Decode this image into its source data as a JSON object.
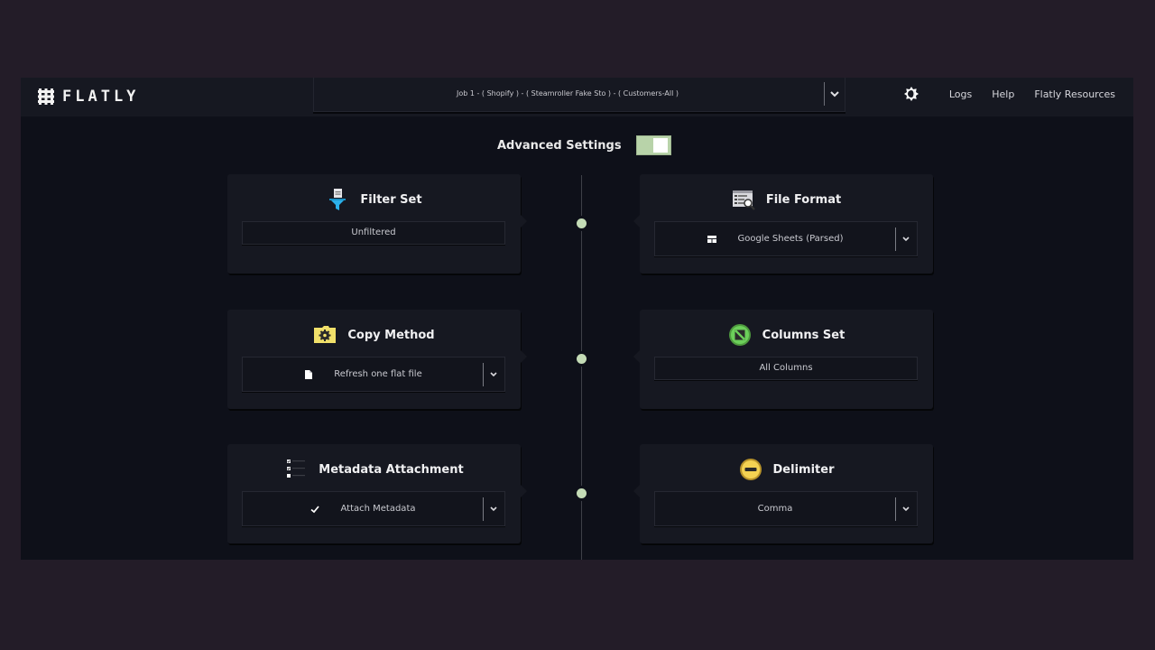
{
  "app": {
    "brand": "FLATLY",
    "job_selector": {
      "value": "Job 1 - ( Shopify ) - ( Steamroller Fake Sto ) - ( Customers-All )"
    },
    "nav": {
      "theme_icon": "theme-toggle-icon",
      "links": [
        "Logs",
        "Help",
        "Flatly Resources"
      ]
    }
  },
  "advanced_settings": {
    "label": "Advanced Settings",
    "enabled": true,
    "toggle_color": "#b8d3a9"
  },
  "cards": {
    "filter_set": {
      "title": "Filter Set",
      "icon": "filter-funnel-icon",
      "value": "Unfiltered"
    },
    "file_format": {
      "title": "File Format",
      "icon": "file-format-icon",
      "value": "Google Sheets (Parsed)",
      "value_icon": "table-icon"
    },
    "copy_method": {
      "title": "Copy Method",
      "icon": "folder-gear-icon",
      "value": "Refresh one flat file",
      "value_icon": "file-icon"
    },
    "columns_set": {
      "title": "Columns Set",
      "icon": "columns-circle-icon",
      "value": "All Columns"
    },
    "metadata_attachment": {
      "title": "Metadata Attachment",
      "icon": "checklist-icon",
      "value": "Attach Metadata",
      "value_icon": "check-icon"
    },
    "delimiter": {
      "title": "Delimiter",
      "icon": "delimiter-circle-icon",
      "value": "Comma"
    }
  },
  "colors": {
    "timeline_dot": "#c4dcb6",
    "filter_icon": "#2bb0ea",
    "copy_icon": "#f1e06a",
    "columns_icon": "#6ccf5a",
    "delimiter_icon": "#f4d252"
  }
}
